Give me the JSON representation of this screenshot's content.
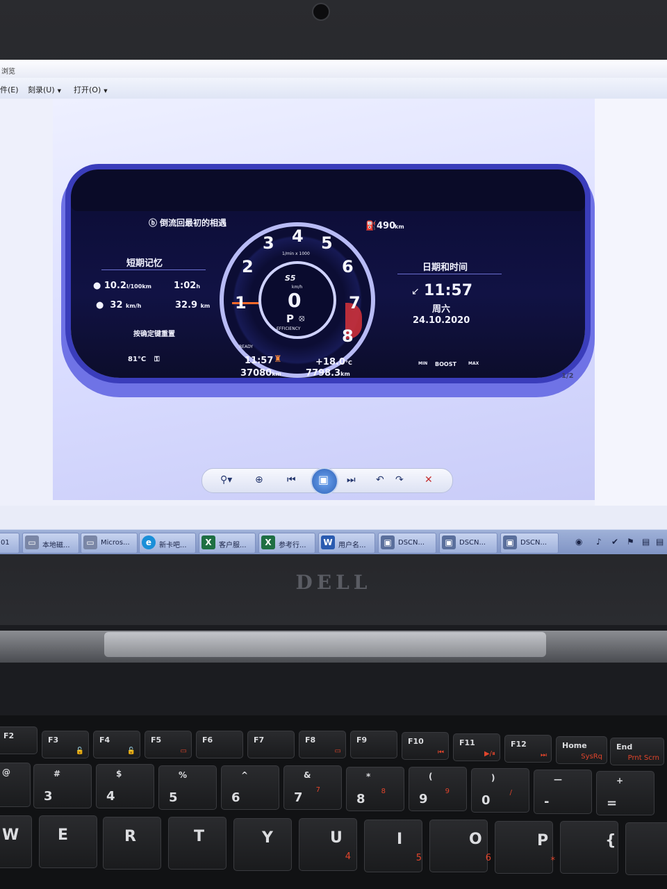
{
  "window": {
    "title_fragment": "浏览"
  },
  "menu": {
    "items": [
      "件(E)",
      "刻录(U)",
      "打开(O)"
    ]
  },
  "cluster": {
    "bluetooth_text": "倒流回最初的相遇",
    "range": "490",
    "range_unit": "km",
    "left_panel_title": "短期记忆",
    "consumption": "10.2",
    "consumption_unit": "l/100km",
    "duration": "1:02",
    "duration_unit": "h",
    "speed": "32",
    "speed_unit": "km/h",
    "distance": "32.9",
    "distance_unit": "km",
    "reset_hint": "按确定键重置",
    "gauge_numbers": [
      "1",
      "2",
      "3",
      "4",
      "5",
      "6",
      "7",
      "8"
    ],
    "rpm_label": "1/min x 1000",
    "model_badge": "S5",
    "speed_value": "0",
    "speed_label": "km/h",
    "gear": "P",
    "efficiency_label": "EFFICIENCY",
    "ready_label": "READY",
    "odometer": "37080",
    "odometer_unit": "km",
    "trip": "7798.3",
    "trip_unit": "km",
    "right_panel_title": "日期和时间",
    "time_large": "11:57",
    "weekday": "周六",
    "date": "24.10.2020",
    "coolant_temp": "81",
    "coolant_unit": "°C",
    "clock_small": "11:57",
    "outside_temp": "+18.0",
    "outside_temp_unit": "°C",
    "boost_min": "MIN",
    "boost_label": "BOOST",
    "boost_max": "MAX",
    "fuel_fraction": "1/2"
  },
  "toolbar": {
    "zoom": "⚲▾",
    "fit": "⊕",
    "prev": "⏮",
    "play": "▣",
    "next": "⏭",
    "rotate_ccw": "↶",
    "rotate_cw": "↷",
    "delete": "✕"
  },
  "taskbar": {
    "items": [
      {
        "label": "01",
        "icon": "doc-icon",
        "color": "#5d6fa8"
      },
      {
        "label": "本地磁...",
        "icon": "drive-icon",
        "color": "#7a86a6"
      },
      {
        "label": "Micros...",
        "icon": "drive-icon",
        "color": "#7a86a6"
      },
      {
        "label": "新卡吧...",
        "icon": "edge-icon",
        "color": "#1a8fd8"
      },
      {
        "label": "客户服...",
        "icon": "excel-icon",
        "color": "#1e6f43"
      },
      {
        "label": "参考行...",
        "icon": "excel-icon",
        "color": "#1e6f43"
      },
      {
        "label": "用户名...",
        "icon": "word-icon",
        "color": "#2a5bb0"
      },
      {
        "label": "DSCN...",
        "icon": "photo-icon",
        "color": "#5a6f9c"
      },
      {
        "label": "DSCN...",
        "icon": "photo-icon",
        "color": "#5a6f9c"
      },
      {
        "label": "DSCN...",
        "icon": "photo-icon",
        "color": "#5a6f9c"
      }
    ]
  },
  "laptop": {
    "brand": "DELL"
  },
  "keyboard": {
    "fkeys": [
      {
        "main": "F2",
        "sub": ""
      },
      {
        "main": "F3",
        "sub": "🔓"
      },
      {
        "main": "F4",
        "sub": "🔓"
      },
      {
        "main": "F5",
        "sub": "▭"
      },
      {
        "main": "F6",
        "sub": ""
      },
      {
        "main": "F7",
        "sub": ""
      },
      {
        "main": "F8",
        "sub": "▭"
      },
      {
        "main": "F9",
        "sub": ""
      },
      {
        "main": "F10",
        "sub": "⏮"
      },
      {
        "main": "F11",
        "sub": "▶/⏸"
      },
      {
        "main": "F12",
        "sub": "⏭"
      },
      {
        "main": "Home",
        "sub": "SysRq"
      },
      {
        "main": "End",
        "sub": "Prnt Scrn"
      }
    ],
    "numrow": [
      {
        "top": "@",
        "bottom": "",
        "sub": ""
      },
      {
        "top": "#",
        "bottom": "3",
        "sub": ""
      },
      {
        "top": "$",
        "bottom": "4",
        "sub": ""
      },
      {
        "top": "%",
        "bottom": "5",
        "sub": ""
      },
      {
        "top": "^",
        "bottom": "6",
        "sub": ""
      },
      {
        "top": "&",
        "bottom": "7",
        "sub": "7"
      },
      {
        "top": "*",
        "bottom": "8",
        "sub": "8"
      },
      {
        "top": "(",
        "bottom": "9",
        "sub": "9"
      },
      {
        "top": ")",
        "bottom": "0",
        "sub": "/"
      },
      {
        "top": "—",
        "bottom": "-",
        "sub": ""
      },
      {
        "top": "+",
        "bottom": "=",
        "sub": ""
      }
    ],
    "letterrow": [
      {
        "main": "W",
        "sub": ""
      },
      {
        "main": "E",
        "sub": ""
      },
      {
        "main": "R",
        "sub": ""
      },
      {
        "main": "T",
        "sub": ""
      },
      {
        "main": "Y",
        "sub": ""
      },
      {
        "main": "U",
        "sub": "4"
      },
      {
        "main": "I",
        "sub": "5"
      },
      {
        "main": "O",
        "sub": "6"
      },
      {
        "main": "P",
        "sub": "*"
      },
      {
        "main": "{",
        "sub": ""
      }
    ]
  }
}
